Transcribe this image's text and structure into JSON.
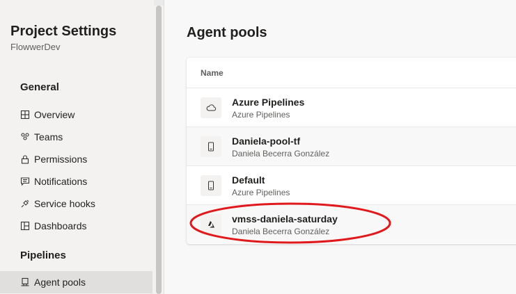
{
  "sidebar": {
    "title": "Project Settings",
    "subtitle": "FlowwerDev",
    "general_heading": "General",
    "general_items": [
      {
        "label": "Overview",
        "icon": "overview-icon"
      },
      {
        "label": "Teams",
        "icon": "teams-icon"
      },
      {
        "label": "Permissions",
        "icon": "lock-icon"
      },
      {
        "label": "Notifications",
        "icon": "notification-icon"
      },
      {
        "label": "Service hooks",
        "icon": "service-hooks-icon"
      },
      {
        "label": "Dashboards",
        "icon": "dashboards-icon"
      }
    ],
    "pipelines_heading": "Pipelines",
    "pipelines_items": [
      {
        "label": "Agent pools",
        "icon": "agent-pools-icon",
        "selected": true
      }
    ]
  },
  "main": {
    "title": "Agent pools",
    "column_header": "Name",
    "pools": [
      {
        "name": "Azure Pipelines",
        "owner": "Azure Pipelines",
        "icon": "cloud-icon"
      },
      {
        "name": "Daniela-pool-tf",
        "owner": "Daniela Becerra González",
        "icon": "device-icon"
      },
      {
        "name": "Default",
        "owner": "Azure Pipelines",
        "icon": "device-icon"
      },
      {
        "name": "vmss-daniela-saturday",
        "owner": "Daniela Becerra González",
        "icon": "azure-icon"
      }
    ]
  },
  "colors": {
    "annotation": "#e0191c",
    "selected_bg": "#e1dfdd"
  }
}
